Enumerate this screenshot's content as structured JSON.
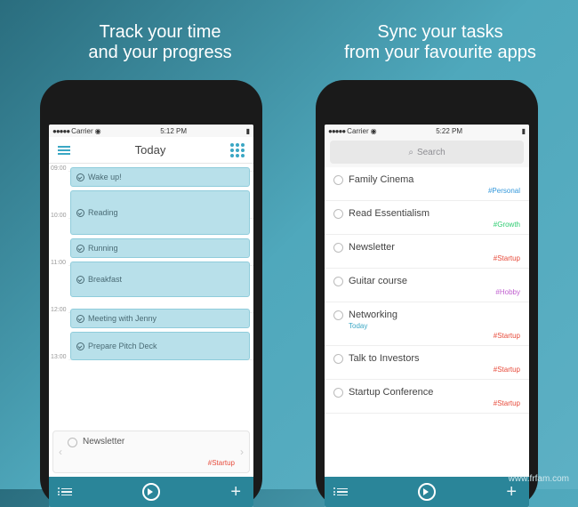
{
  "headlines": {
    "left_l1": "Track your time",
    "left_l2": "and your progress",
    "right_l1": "Sync your tasks",
    "right_l2": "from your favourite apps"
  },
  "left": {
    "status": {
      "carrier": "Carrier",
      "time": "5:12 PM"
    },
    "nav_title": "Today",
    "times": {
      "t0": "09:00",
      "t1": "10:00",
      "t2": "11:00",
      "t3": "12:00",
      "t4": "13:00"
    },
    "tasks": {
      "wake": "Wake up!",
      "reading": "Reading",
      "running": "Running",
      "breakfast": "Breakfast",
      "meeting": "Meeting with Jenny",
      "pitch": "Prepare Pitch Deck"
    },
    "new_task": {
      "title": "Newsletter",
      "tag": "#Startup"
    }
  },
  "right": {
    "status": {
      "carrier": "Carrier",
      "time": "5:22 PM"
    },
    "search_placeholder": "Search",
    "items": [
      {
        "title": "Family Cinema",
        "tag": "#Personal",
        "tag_class": "tag-personal"
      },
      {
        "title": "Read Essentialism",
        "tag": "#Growth",
        "tag_class": "tag-growth"
      },
      {
        "title": "Newsletter",
        "tag": "#Startup",
        "tag_class": "tag-startup"
      },
      {
        "title": "Guitar course",
        "tag": "#Hobby",
        "tag_class": "tag-hobby"
      },
      {
        "title": "Networking",
        "sub": "Today",
        "tag": "#Startup",
        "tag_class": "tag-startup"
      },
      {
        "title": "Talk to Investors",
        "tag": "#Startup",
        "tag_class": "tag-startup"
      },
      {
        "title": "Startup Conference",
        "tag": "#Startup",
        "tag_class": "tag-startup"
      }
    ]
  },
  "watermark": "www.frfam.com"
}
